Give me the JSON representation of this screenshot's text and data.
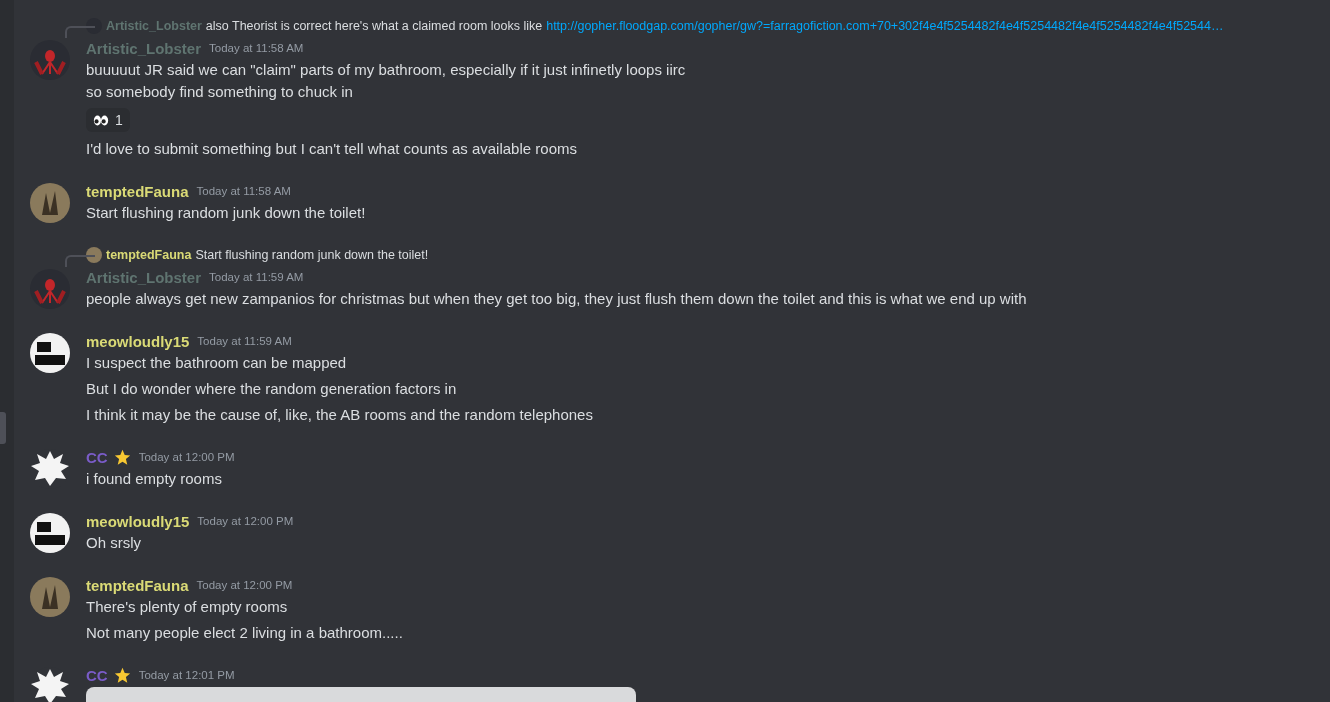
{
  "messages": [
    {
      "author": "Artistic_Lobster",
      "color": "#5f7470",
      "kind": "dark",
      "time": "Today at 11:58 AM",
      "badge": false,
      "reply": {
        "author": "Artistic_Lobster",
        "color": "#5f7470",
        "kind": "dark",
        "text": "also Theorist is correct here's what a claimed room looks like",
        "link": "http://gopher.floodgap.com/gopher/gw?=farragofiction.com+70+302f4e4f5254482f4e4f5254482f4e4f5254482f4e4f52544…"
      },
      "body": [
        {
          "kind": "text",
          "text": "buuuuut JR said we can \"claim\" parts of my bathroom, especially if it just infinetly loops iirc\nso somebody find something to chuck in"
        },
        {
          "kind": "reaction",
          "count": "1"
        },
        {
          "kind": "text",
          "text": "I'd love to submit something but I can't tell what counts as available rooms"
        }
      ]
    },
    {
      "author": "temptedFauna",
      "color": "#dada76",
      "kind": "brown",
      "time": "Today at 11:58 AM",
      "badge": false,
      "body": [
        {
          "kind": "text",
          "text": "Start flushing random junk down the toilet!"
        }
      ]
    },
    {
      "author": "Artistic_Lobster",
      "color": "#5f7470",
      "kind": "dark",
      "time": "Today at 11:59 AM",
      "badge": false,
      "reply": {
        "author": "temptedFauna",
        "color": "#dada76",
        "kind": "brown",
        "text": "Start flushing random junk down the toilet!"
      },
      "body": [
        {
          "kind": "text",
          "text": "people always get new zampanios for christmas but when they get too big, they just flush them down the toilet and this is what we end up with"
        }
      ]
    },
    {
      "author": "meowloudly15",
      "color": "#dada76",
      "kind": "white",
      "time": "Today at 11:59 AM",
      "badge": false,
      "body": [
        {
          "kind": "text",
          "text": "I suspect the bathroom can be mapped"
        },
        {
          "kind": "text",
          "text": "But I do wonder where the random generation factors in"
        },
        {
          "kind": "text",
          "text": "I think it may be the cause of, like, the AB rooms and the random telephones"
        }
      ]
    },
    {
      "author": "CC",
      "color": "#7a5cc8",
      "kind": "spiky",
      "time": "Today at 12:00 PM",
      "badge": true,
      "body": [
        {
          "kind": "text",
          "text": "i found empty rooms"
        }
      ]
    },
    {
      "author": "meowloudly15",
      "color": "#dada76",
      "kind": "white",
      "time": "Today at 12:00 PM",
      "badge": false,
      "body": [
        {
          "kind": "text",
          "text": "Oh srsly"
        }
      ]
    },
    {
      "author": "temptedFauna",
      "color": "#dada76",
      "kind": "brown",
      "time": "Today at 12:00 PM",
      "badge": false,
      "body": [
        {
          "kind": "text",
          "text": "There's plenty of empty rooms"
        },
        {
          "kind": "text",
          "text": "Not many people elect 2 living in a bathroom....."
        }
      ]
    },
    {
      "author": "CC",
      "color": "#7a5cc8",
      "kind": "spiky",
      "time": "Today at 12:01 PM",
      "badge": true,
      "body": [
        {
          "kind": "image"
        }
      ]
    }
  ]
}
